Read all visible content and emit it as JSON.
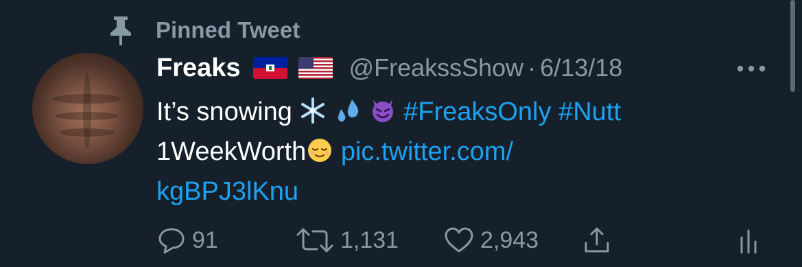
{
  "pinned": {
    "label": "Pinned Tweet",
    "icon": "pin-icon"
  },
  "tweet": {
    "display_name": "Freaks",
    "flags": [
      "haiti-flag-icon",
      "us-flag-icon"
    ],
    "handle": "@FreakssShow",
    "separator": "·",
    "date": "6/13/18",
    "text_intro": "It’s snowing ",
    "emoji_line1": [
      "snowflake-emoji",
      "sweat-droplets-emoji",
      "smiling-devil-emoji"
    ],
    "hashtag1": "#FreaksOnly",
    "hashtag2_part1": "#Nutt",
    "hashtag2_part2": "1WeekWorth",
    "emoji_line2": "relieved-face-emoji",
    "link": "pic.twitter.com/kgBPJ3lKnu",
    "link_part1": "pic.twitter.com/",
    "link_part2": "kgBPJ3lKnu"
  },
  "actions": {
    "replies": "91",
    "retweets": "1,131",
    "likes": "2,943"
  },
  "colors": {
    "background": "#15202b",
    "text": "#ffffff",
    "secondary": "#8899a6",
    "link": "#1da1f2"
  }
}
